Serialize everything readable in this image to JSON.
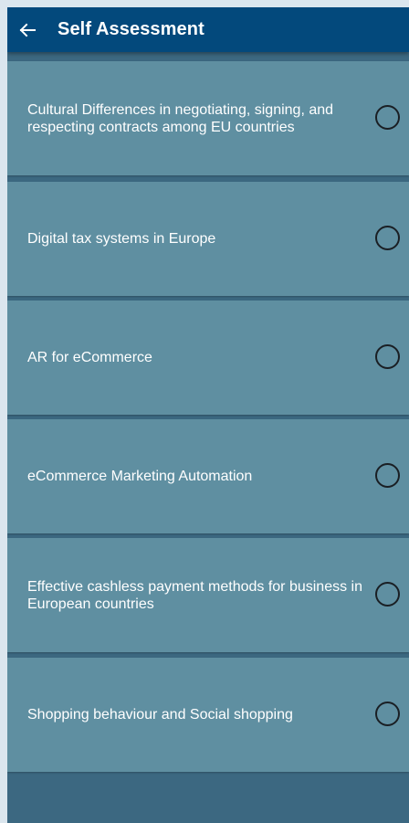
{
  "app_bar": {
    "title": "Self Assessment",
    "back_icon": "arrow-left-icon"
  },
  "topics": [
    {
      "label": "Cultural Differences in negotiating, signing, and respecting contracts among EU countries",
      "selected": false
    },
    {
      "label": "Digital tax systems in Europe",
      "selected": false
    },
    {
      "label": "AR for eCommerce",
      "selected": false
    },
    {
      "label": "eCommerce Marketing Automation",
      "selected": false
    },
    {
      "label": "Effective cashless payment methods for business in European countries",
      "selected": false
    },
    {
      "label": "Shopping behaviour and Social shopping",
      "selected": false
    }
  ],
  "colors": {
    "app_bar": "#03497c",
    "card": "#5f8fa1",
    "separator": "#3c6881",
    "radio_border": "#1a1f24",
    "text": "#ffffff"
  }
}
